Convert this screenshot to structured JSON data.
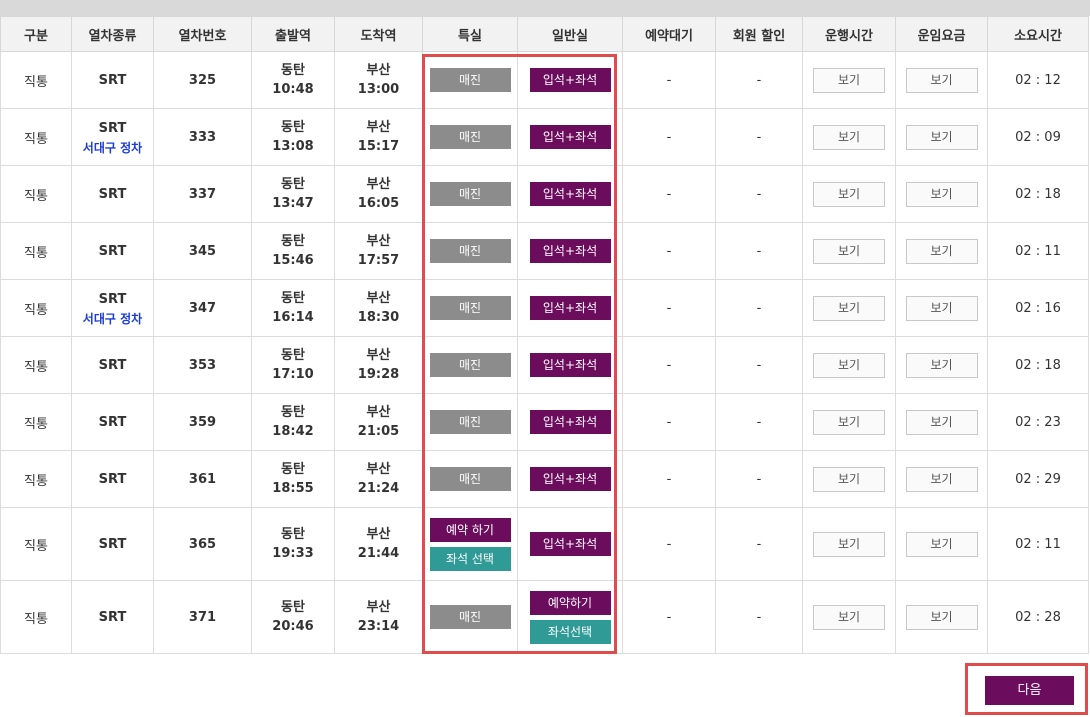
{
  "headers": [
    "구분",
    "열차종류",
    "열차번호",
    "출발역",
    "도착역",
    "특실",
    "일반실",
    "예약대기",
    "회원 할인",
    "운행시간",
    "운임요금",
    "소요시간"
  ],
  "rows": [
    {
      "type": "직통",
      "train": "SRT",
      "sub": "",
      "no": "325",
      "dep_st": "동탄",
      "dep_time": "10:48",
      "arr_st": "부산",
      "arr_time": "13:00",
      "wait": "-",
      "disc": "-",
      "view_time": "보기",
      "view_fare": "보기",
      "dur": "02 : 12",
      "first_a": "매진",
      "first_b": "",
      "normal_a": "입석+좌석",
      "normal_b": ""
    },
    {
      "type": "직통",
      "train": "SRT",
      "sub": "서대구 정차",
      "no": "333",
      "dep_st": "동탄",
      "dep_time": "13:08",
      "arr_st": "부산",
      "arr_time": "15:17",
      "wait": "-",
      "disc": "-",
      "view_time": "보기",
      "view_fare": "보기",
      "dur": "02 : 09",
      "first_a": "매진",
      "first_b": "",
      "normal_a": "입석+좌석",
      "normal_b": ""
    },
    {
      "type": "직통",
      "train": "SRT",
      "sub": "",
      "no": "337",
      "dep_st": "동탄",
      "dep_time": "13:47",
      "arr_st": "부산",
      "arr_time": "16:05",
      "wait": "-",
      "disc": "-",
      "view_time": "보기",
      "view_fare": "보기",
      "dur": "02 : 18",
      "first_a": "매진",
      "first_b": "",
      "normal_a": "입석+좌석",
      "normal_b": ""
    },
    {
      "type": "직통",
      "train": "SRT",
      "sub": "",
      "no": "345",
      "dep_st": "동탄",
      "dep_time": "15:46",
      "arr_st": "부산",
      "arr_time": "17:57",
      "wait": "-",
      "disc": "-",
      "view_time": "보기",
      "view_fare": "보기",
      "dur": "02 : 11",
      "first_a": "매진",
      "first_b": "",
      "normal_a": "입석+좌석",
      "normal_b": ""
    },
    {
      "type": "직통",
      "train": "SRT",
      "sub": "서대구 정차",
      "no": "347",
      "dep_st": "동탄",
      "dep_time": "16:14",
      "arr_st": "부산",
      "arr_time": "18:30",
      "wait": "-",
      "disc": "-",
      "view_time": "보기",
      "view_fare": "보기",
      "dur": "02 : 16",
      "first_a": "매진",
      "first_b": "",
      "normal_a": "입석+좌석",
      "normal_b": ""
    },
    {
      "type": "직통",
      "train": "SRT",
      "sub": "",
      "no": "353",
      "dep_st": "동탄",
      "dep_time": "17:10",
      "arr_st": "부산",
      "arr_time": "19:28",
      "wait": "-",
      "disc": "-",
      "view_time": "보기",
      "view_fare": "보기",
      "dur": "02 : 18",
      "first_a": "매진",
      "first_b": "",
      "normal_a": "입석+좌석",
      "normal_b": ""
    },
    {
      "type": "직통",
      "train": "SRT",
      "sub": "",
      "no": "359",
      "dep_st": "동탄",
      "dep_time": "18:42",
      "arr_st": "부산",
      "arr_time": "21:05",
      "wait": "-",
      "disc": "-",
      "view_time": "보기",
      "view_fare": "보기",
      "dur": "02 : 23",
      "first_a": "매진",
      "first_b": "",
      "normal_a": "입석+좌석",
      "normal_b": ""
    },
    {
      "type": "직통",
      "train": "SRT",
      "sub": "",
      "no": "361",
      "dep_st": "동탄",
      "dep_time": "18:55",
      "arr_st": "부산",
      "arr_time": "21:24",
      "wait": "-",
      "disc": "-",
      "view_time": "보기",
      "view_fare": "보기",
      "dur": "02 : 29",
      "first_a": "매진",
      "first_b": "",
      "normal_a": "입석+좌석",
      "normal_b": ""
    },
    {
      "type": "직통",
      "train": "SRT",
      "sub": "",
      "no": "365",
      "dep_st": "동탄",
      "dep_time": "19:33",
      "arr_st": "부산",
      "arr_time": "21:44",
      "wait": "-",
      "disc": "-",
      "view_time": "보기",
      "view_fare": "보기",
      "dur": "02 : 11",
      "first_a": "예약 하기",
      "first_b": "좌석 선택",
      "normal_a": "입석+좌석",
      "normal_b": ""
    },
    {
      "type": "직통",
      "train": "SRT",
      "sub": "",
      "no": "371",
      "dep_st": "동탄",
      "dep_time": "20:46",
      "arr_st": "부산",
      "arr_time": "23:14",
      "wait": "-",
      "disc": "-",
      "view_time": "보기",
      "view_fare": "보기",
      "dur": "02 : 28",
      "first_a": "매진",
      "first_b": "",
      "normal_a": "예약하기",
      "normal_b": "좌석선택"
    }
  ],
  "next_label": "다음",
  "colors": {
    "purple": "#6c0c5c",
    "gray": "#8c8c8c",
    "teal": "#2f9a96",
    "highlight": "#e04c4c",
    "sub_blue": "#1a3dd6"
  }
}
